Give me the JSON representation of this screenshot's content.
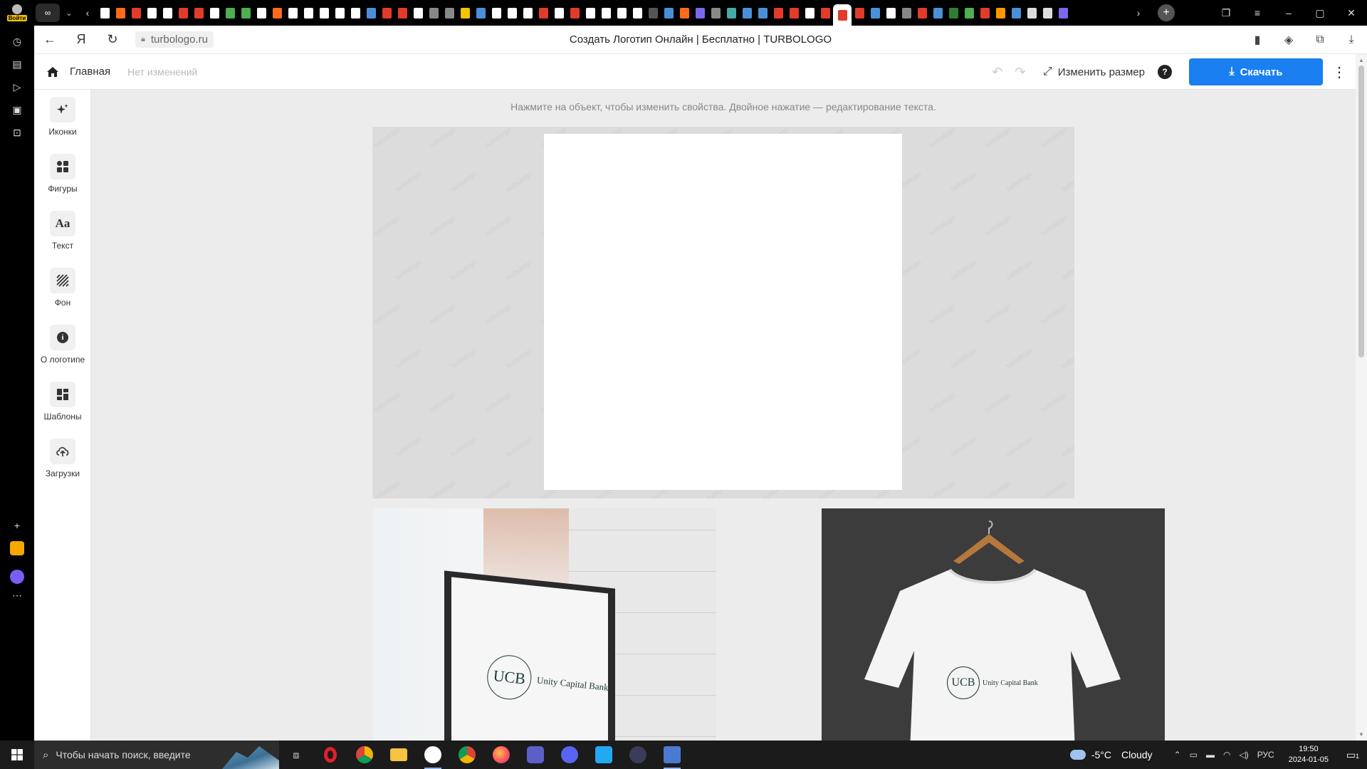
{
  "browser": {
    "profile_label": "Войти",
    "url": "turbologo.ru",
    "page_title": "Создать Логотип Онлайн | Бесплатно | TURBOLOGO",
    "tab_colors": [
      "#ffffff",
      "#ff6b1a",
      "#e23b2a",
      "#ffffff",
      "#ffffff",
      "#e23b2a",
      "#e23b2a",
      "#ffffff",
      "#4caf50",
      "#4caf50",
      "#ffffff",
      "#ff6b1a",
      "#ffffff",
      "#ffffff",
      "#ffffff",
      "#ffffff",
      "#ffffff",
      "#4a90d9",
      "#e23b2a",
      "#e23b2a",
      "#ffffff",
      "#888888",
      "#888888",
      "#f5c400",
      "#4a90d9",
      "#ffffff",
      "#ffffff",
      "#ffffff",
      "#e23b2a",
      "#ffffff",
      "#e23b2a",
      "#ffffff",
      "#ffffff",
      "#ffffff",
      "#ffffff",
      "#555555",
      "#4a90d9",
      "#ff6b1a",
      "#7b68ee",
      "#888888",
      "#4aa",
      "#4a90d9",
      "#4a90d9",
      "#e23b2a",
      "#e23b2a",
      "#ffffff",
      "#e23b2a",
      "#e23b2a",
      "#e23b2a",
      "#4a90d9",
      "#ffffff",
      "#888888",
      "#e23b2a",
      "#4a90d9",
      "#2e7d32",
      "#4caf50",
      "#e23b2a",
      "#ff9800",
      "#4a90d9",
      "#dddddd",
      "#dddddd",
      "#7b68ee"
    ]
  },
  "app": {
    "breadcrumb_home": "Главная",
    "status": "Нет изменений",
    "resize_label": "Изменить размер",
    "help_label": "?",
    "download_label": "Скачать",
    "hint": "Нажмите на объект, чтобы изменить свойства. Двойное нажатие — редактирование текста.",
    "tools": [
      {
        "label": "Иконки",
        "icon": "sparkle-icon"
      },
      {
        "label": "Фигуры",
        "icon": "shapes-icon"
      },
      {
        "label": "Текст",
        "icon": "text-icon"
      },
      {
        "label": "Фон",
        "icon": "background-icon"
      },
      {
        "label": "О логотипе",
        "icon": "info-icon"
      },
      {
        "label": "Шаблоны",
        "icon": "templates-icon"
      },
      {
        "label": "Загрузки",
        "icon": "upload-icon"
      }
    ],
    "tool_glyphs": {
      "text": "Aa",
      "info": "i"
    },
    "watermark": "turbologo",
    "mockup_logo": {
      "abbr": "UCB",
      "name": "Unity Capital Bank"
    }
  },
  "taskbar": {
    "search_placeholder": "Чтобы начать поиск, введите",
    "temperature": "-5°C",
    "weather": "Cloudy",
    "lang": "РУС",
    "time": "19:50",
    "date": "2024-01-05",
    "notif_count": "1"
  }
}
